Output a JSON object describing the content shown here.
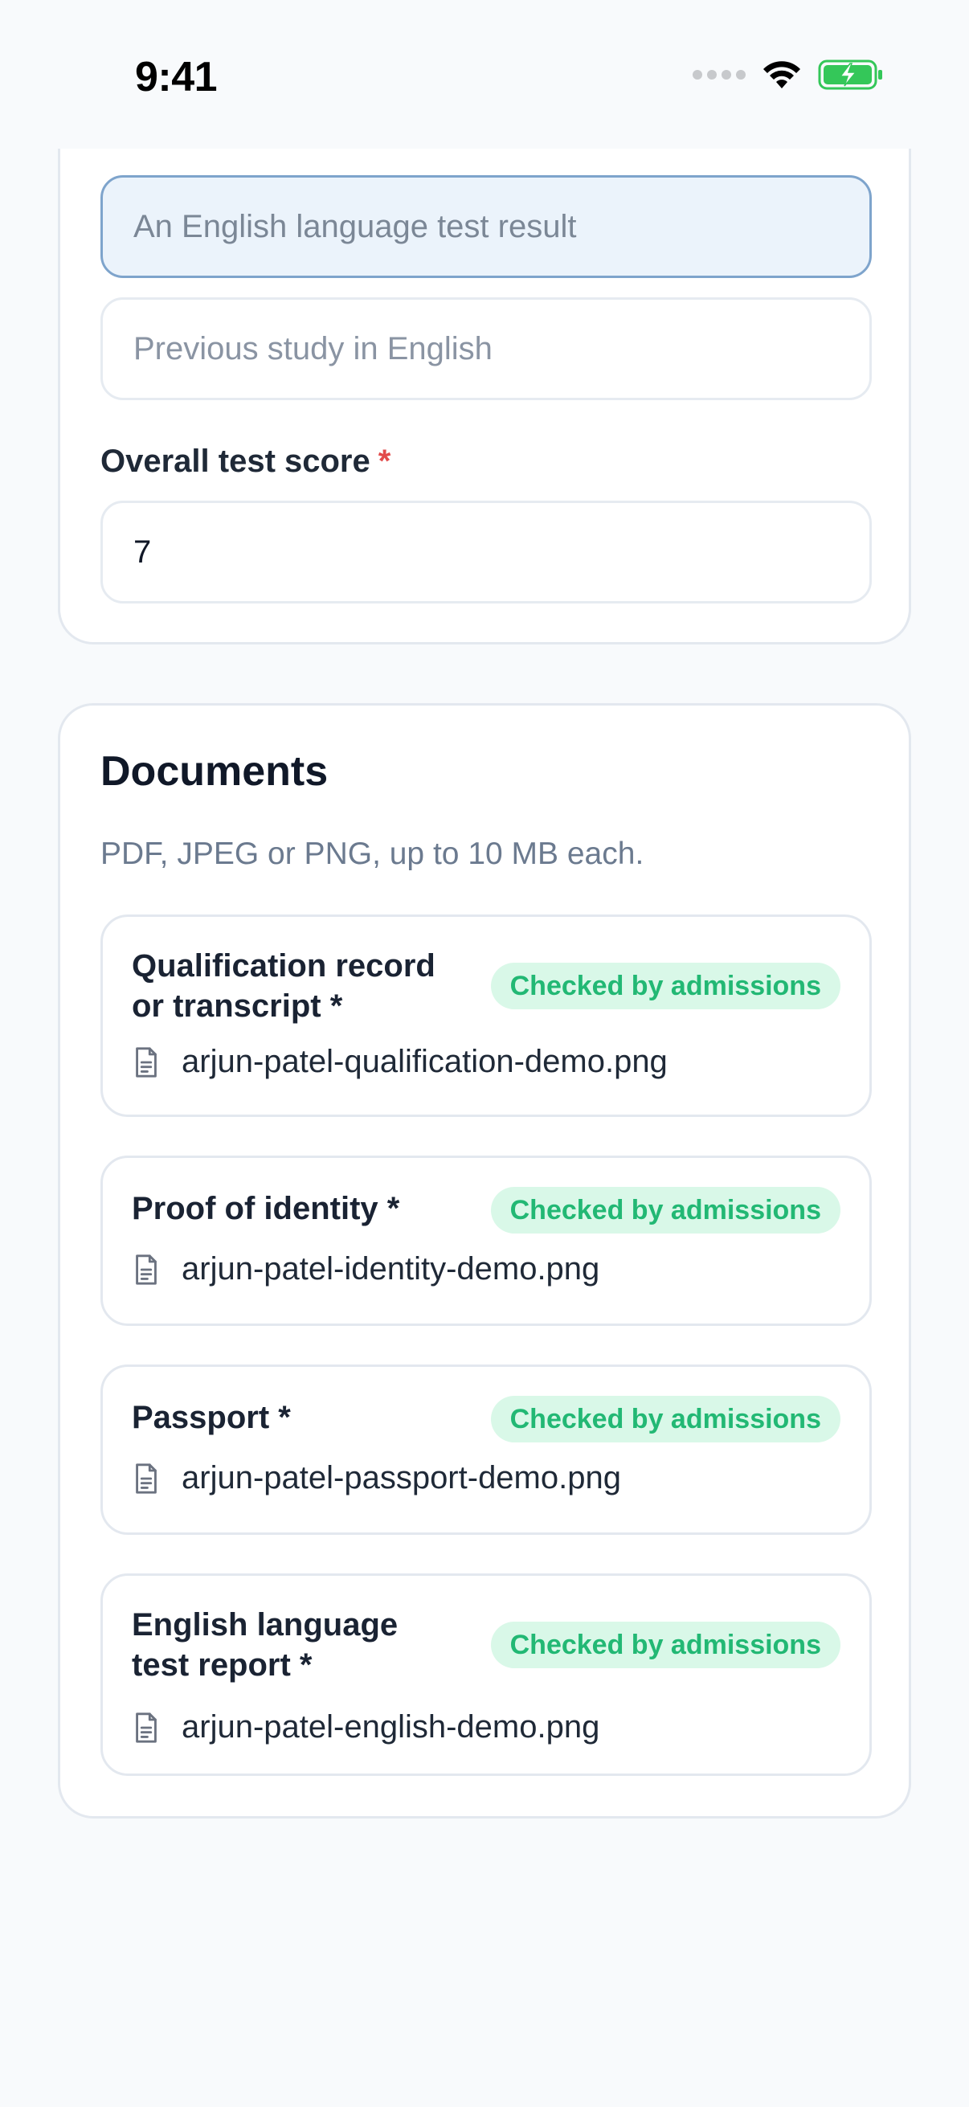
{
  "status_bar": {
    "time": "9:41"
  },
  "english_section": {
    "options": [
      {
        "label": "An English language test result",
        "selected": true
      },
      {
        "label": "Previous study in English",
        "selected": false
      }
    ],
    "score_field": {
      "label": "Overall test score",
      "required_marker": "*",
      "value": "7"
    }
  },
  "documents": {
    "title": "Documents",
    "subtitle": "PDF, JPEG or PNG, up to 10 MB each.",
    "items": [
      {
        "title_line1": "Qualification record",
        "title_line2": "or transcript *",
        "badge": "Checked by admissions",
        "file_name": "arjun-patel-qualification-demo.png",
        "icon": "file-icon"
      },
      {
        "title_line1": "Proof of identity *",
        "title_line2": "",
        "badge": "Checked by admissions",
        "file_name": "arjun-patel-identity-demo.png",
        "icon": "file-icon"
      },
      {
        "title_line1": "Passport *",
        "title_line2": "",
        "badge": "Checked by admissions",
        "file_name": "arjun-patel-passport-demo.png",
        "icon": "file-icon"
      },
      {
        "title_line1": "English language",
        "title_line2": "test report *",
        "badge": "Checked by admissions",
        "file_name": "arjun-patel-english-demo.png",
        "icon": "file-icon"
      }
    ]
  },
  "colors": {
    "badge_bg": "#d9f8e8",
    "badge_text": "#22b874",
    "selected_bg": "#ebf3fb",
    "selected_border": "#7ea4cc",
    "required": "#e24a4a"
  }
}
